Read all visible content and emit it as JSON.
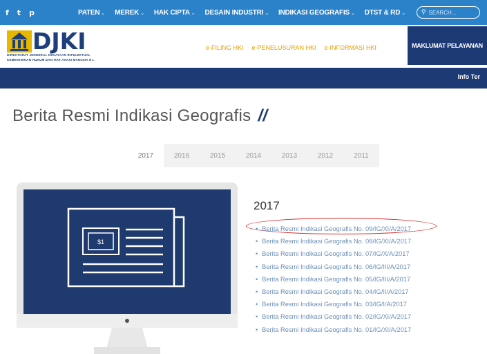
{
  "social": {
    "icons": [
      "f",
      "t",
      "p"
    ]
  },
  "top_nav": {
    "items": [
      {
        "label": "PATEN"
      },
      {
        "label": "MEREK"
      },
      {
        "label": "HAK CIPTA"
      },
      {
        "label": "DESAIN INDUSTRI"
      },
      {
        "label": "INDIKASI GEOGRAFIS"
      },
      {
        "label": "DTST & RD"
      }
    ],
    "caret": "⌄",
    "search_icon": "⚲",
    "search_placeholder": "SEARCH..."
  },
  "header": {
    "logo_text": "DJKI",
    "logo_sub_1": "DIREKTORAT JENDERAL KEKAYAAN INTELEKTUAL",
    "logo_sub_2": "KEMENTERIAN HUKUM DAN HAK ASASI MANUSIA R.I.",
    "links": [
      "e-FILING HKI",
      "e-PENELUSURAN HKI",
      "e-INFORMASI HKI"
    ],
    "maklumat": "MAKLUMAT PELAYANAN"
  },
  "darkbar": {
    "text": "Info Ter"
  },
  "page": {
    "title": "Berita Resmi Indikasi Geografis",
    "title_suffix": "//"
  },
  "year_tabs": [
    "2017",
    "2016",
    "2015",
    "2014",
    "2013",
    "2012",
    "2011"
  ],
  "list": {
    "year": "2017",
    "items": [
      "Berita Resmi Indikasi Geografis No. 09/IG/XI/A/2017",
      "Berita Resmi Indikasi Geografis No. 08/IG/XI/A/2017",
      "Berita Resmi Indikasi Geografis No. 07/IG/X/A/2017",
      "Berita Resmi Indikasi Geografis No. 06/IG/III/A/2017",
      "Berita Resmi Indikasi Geografis No. 05/IG/III/A/2017",
      "Berita Resmi Indikasi Geografis No. 04/IG/II/A/2017",
      "Berita Resmi Indikasi Geografis No. 03/IG/I/A/2017",
      "Berita Resmi Indikasi Geografis No. 02/IG/XI/A/2017",
      "Berita Resmi Indikasi Geografis No. 01/IG/XI/A/2017"
    ],
    "bullet": "•"
  },
  "colors": {
    "topbar": "#2c82c9",
    "navy": "#1e3a75",
    "accent": "#e8a100",
    "link": "#6c8fb8",
    "highlight": "#d8262a"
  }
}
